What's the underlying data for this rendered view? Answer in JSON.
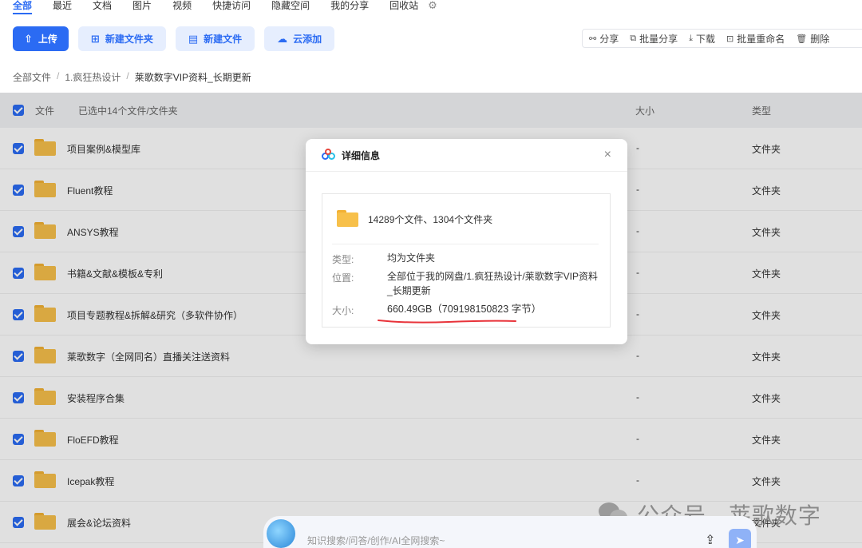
{
  "tabs": [
    "全部",
    "最近",
    "文档",
    "图片",
    "视频",
    "快捷访问",
    "隐藏空间",
    "我的分享",
    "回收站"
  ],
  "toolbar": {
    "upload": "上传",
    "new_folder": "新建文件夹",
    "new_file": "新建文件",
    "cloud_add": "云添加"
  },
  "actions": {
    "share": "分享",
    "batch_share": "批量分享",
    "download": "下载",
    "batch_rename": "批量重命名",
    "delete": "删除"
  },
  "breadcrumb": {
    "root": "全部文件",
    "level1": "1.疯狂热设计",
    "current": "莱歌数字VIP资料_长期更新"
  },
  "table": {
    "col_file": "文件",
    "selected_text": "已选中14个文件/文件夹",
    "col_size": "大小",
    "col_type": "类型",
    "rows": [
      {
        "name": "项目案例&模型库",
        "size": "-",
        "type": "文件夹"
      },
      {
        "name": "Fluent教程",
        "size": "-",
        "type": "文件夹"
      },
      {
        "name": "ANSYS教程",
        "size": "-",
        "type": "文件夹"
      },
      {
        "name": "书籍&文献&模板&专利",
        "size": "-",
        "type": "文件夹"
      },
      {
        "name": "项目专题教程&拆解&研究（多软件协作）",
        "size": "-",
        "type": "文件夹"
      },
      {
        "name": "莱歌数字（全网同名）直播关注送资料",
        "size": "-",
        "type": "文件夹"
      },
      {
        "name": "安装程序合集",
        "size": "-",
        "type": "文件夹"
      },
      {
        "name": "FloEFD教程",
        "size": "-",
        "type": "文件夹"
      },
      {
        "name": "Icepak教程",
        "size": "-",
        "type": "文件夹"
      },
      {
        "name": "展会&论坛资料",
        "size": "-",
        "type": "文件夹"
      }
    ]
  },
  "modal": {
    "title": "详细信息",
    "close": "×",
    "count": "14289个文件、1304个文件夹",
    "type_label": "类型:",
    "type_value": "均为文件夹",
    "location_label": "位置:",
    "location_value": "全部位于我的网盘/1.疯狂热设计/莱歌数字VIP资料_长期更新",
    "size_label": "大小:",
    "size_value": "660.49GB（709198150823 字节）"
  },
  "watermark": "公众号 · 莱歌数字",
  "search": {
    "placeholder": "知识搜索/问答/创作/AI全网搜索~"
  },
  "colors": {
    "accent": "#2b6bf3",
    "annotation_underline": "#e8333a"
  }
}
